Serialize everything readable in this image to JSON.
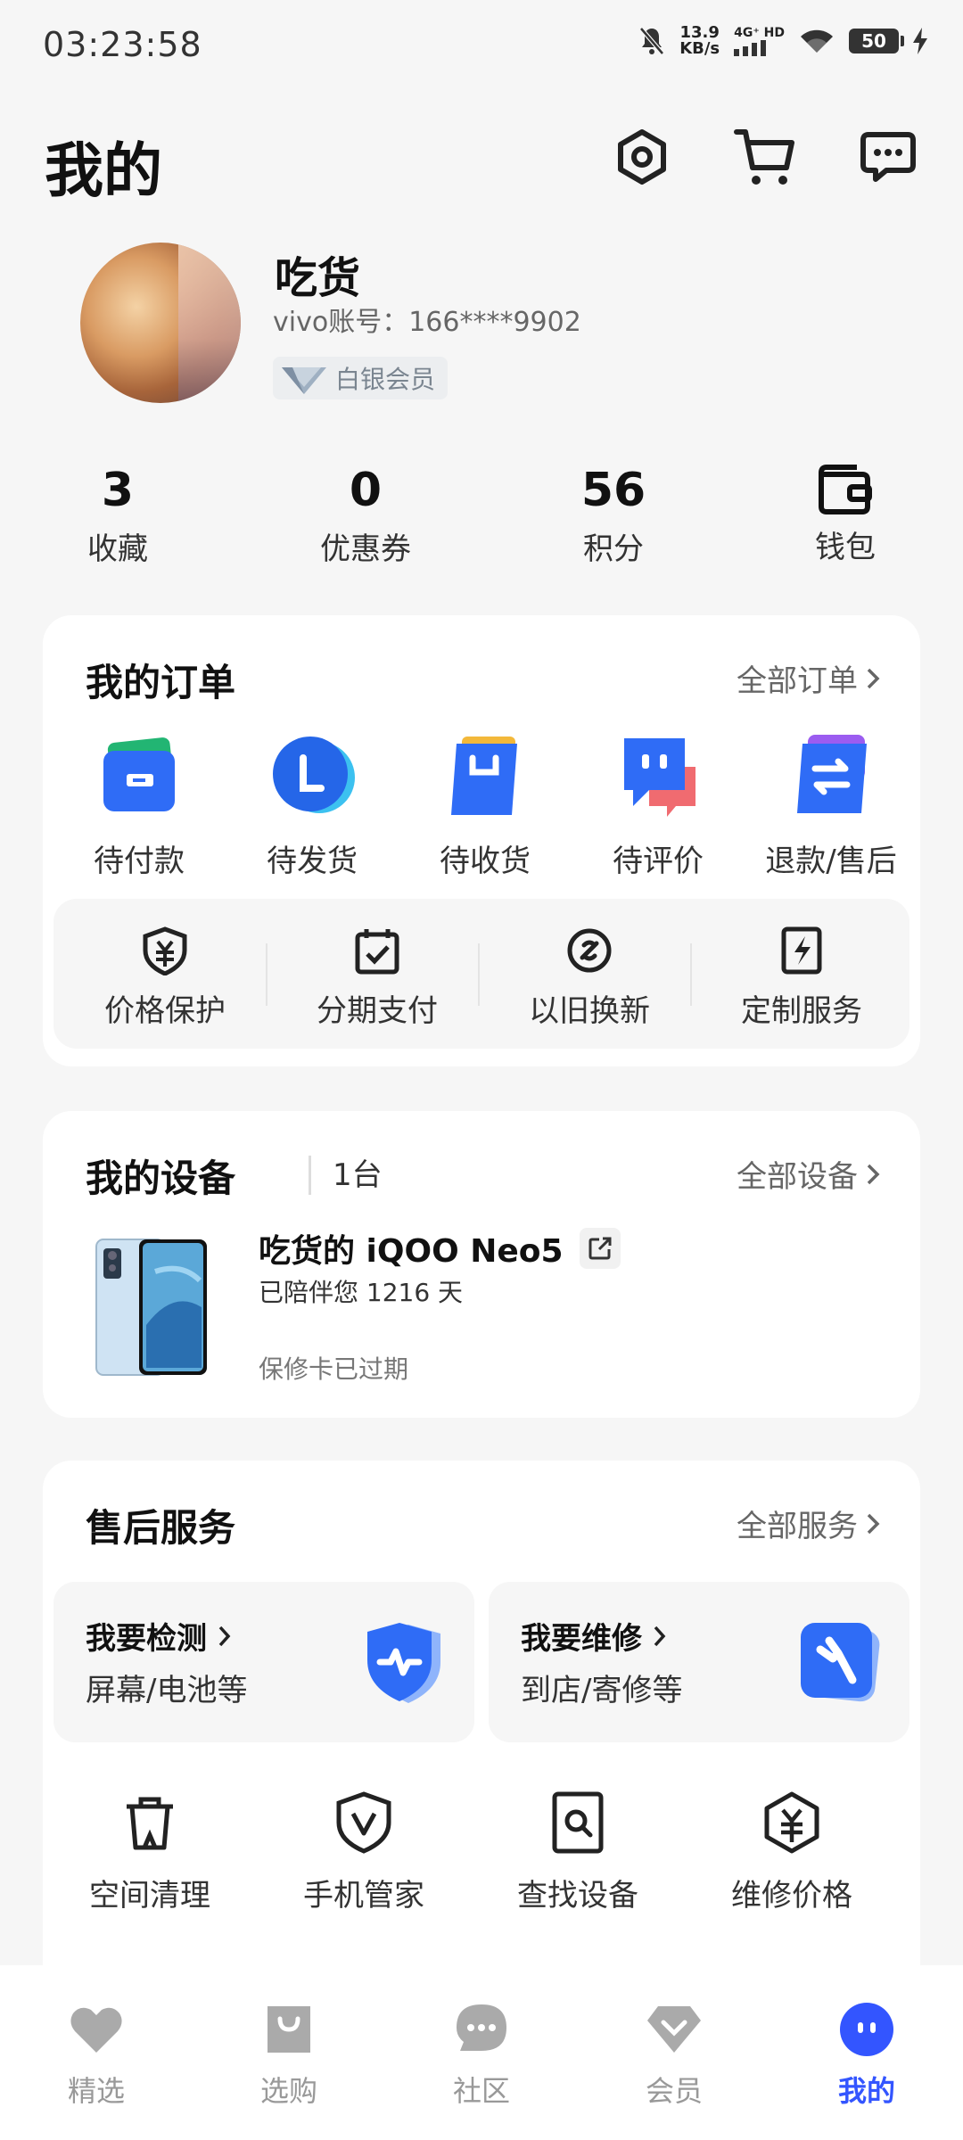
{
  "status": {
    "time": "03:23:58",
    "speed_value": "13.9",
    "speed_unit": "KB/s",
    "network": "4G⁺ HD",
    "battery": "50"
  },
  "header": {
    "title": "我的"
  },
  "user": {
    "name": "吃货",
    "account": "vivo账号：166****9902",
    "member_level": "白银会员"
  },
  "stats": [
    {
      "value": "3",
      "label": "收藏"
    },
    {
      "value": "0",
      "label": "优惠券"
    },
    {
      "value": "56",
      "label": "积分"
    },
    {
      "label": "钱包"
    }
  ],
  "orders": {
    "title": "我的订单",
    "more": "全部订单",
    "items": [
      {
        "label": "待付款",
        "icon": "wallet-card-icon"
      },
      {
        "label": "待发货",
        "icon": "delivery-l-icon"
      },
      {
        "label": "待收货",
        "icon": "shopping-bag-icon"
      },
      {
        "label": "待评价",
        "icon": "comment-icon"
      },
      {
        "label": "退款/售后",
        "icon": "exchange-icon"
      }
    ],
    "services": [
      {
        "label": "价格保护",
        "icon": "price-shield-icon"
      },
      {
        "label": "分期支付",
        "icon": "calendar-check-icon"
      },
      {
        "label": "以旧换新",
        "icon": "trade-in-icon"
      },
      {
        "label": "定制服务",
        "icon": "lightning-doc-icon"
      }
    ]
  },
  "devices": {
    "title": "我的设备",
    "count": "1台",
    "more": "全部设备",
    "device": {
      "name": "吃货的 iQOO Neo5",
      "days": "已陪伴您 1216 天",
      "warranty": "保修卡已过期"
    }
  },
  "after_sales": {
    "title": "售后服务",
    "more": "全部服务",
    "boxes": [
      {
        "title": "我要检测",
        "sub": "屏幕/电池等"
      },
      {
        "title": "我要维修",
        "sub": "到店/寄修等"
      }
    ],
    "tools": [
      {
        "label": "空间清理"
      },
      {
        "label": "手机管家"
      },
      {
        "label": "查找设备"
      },
      {
        "label": "维修价格"
      }
    ]
  },
  "nav": [
    {
      "label": "精选"
    },
    {
      "label": "选购"
    },
    {
      "label": "社区"
    },
    {
      "label": "会员"
    },
    {
      "label": "我的"
    }
  ],
  "colors": {
    "accent": "#3355ff",
    "card": "#ffffff",
    "background": "#f6f6f6"
  }
}
